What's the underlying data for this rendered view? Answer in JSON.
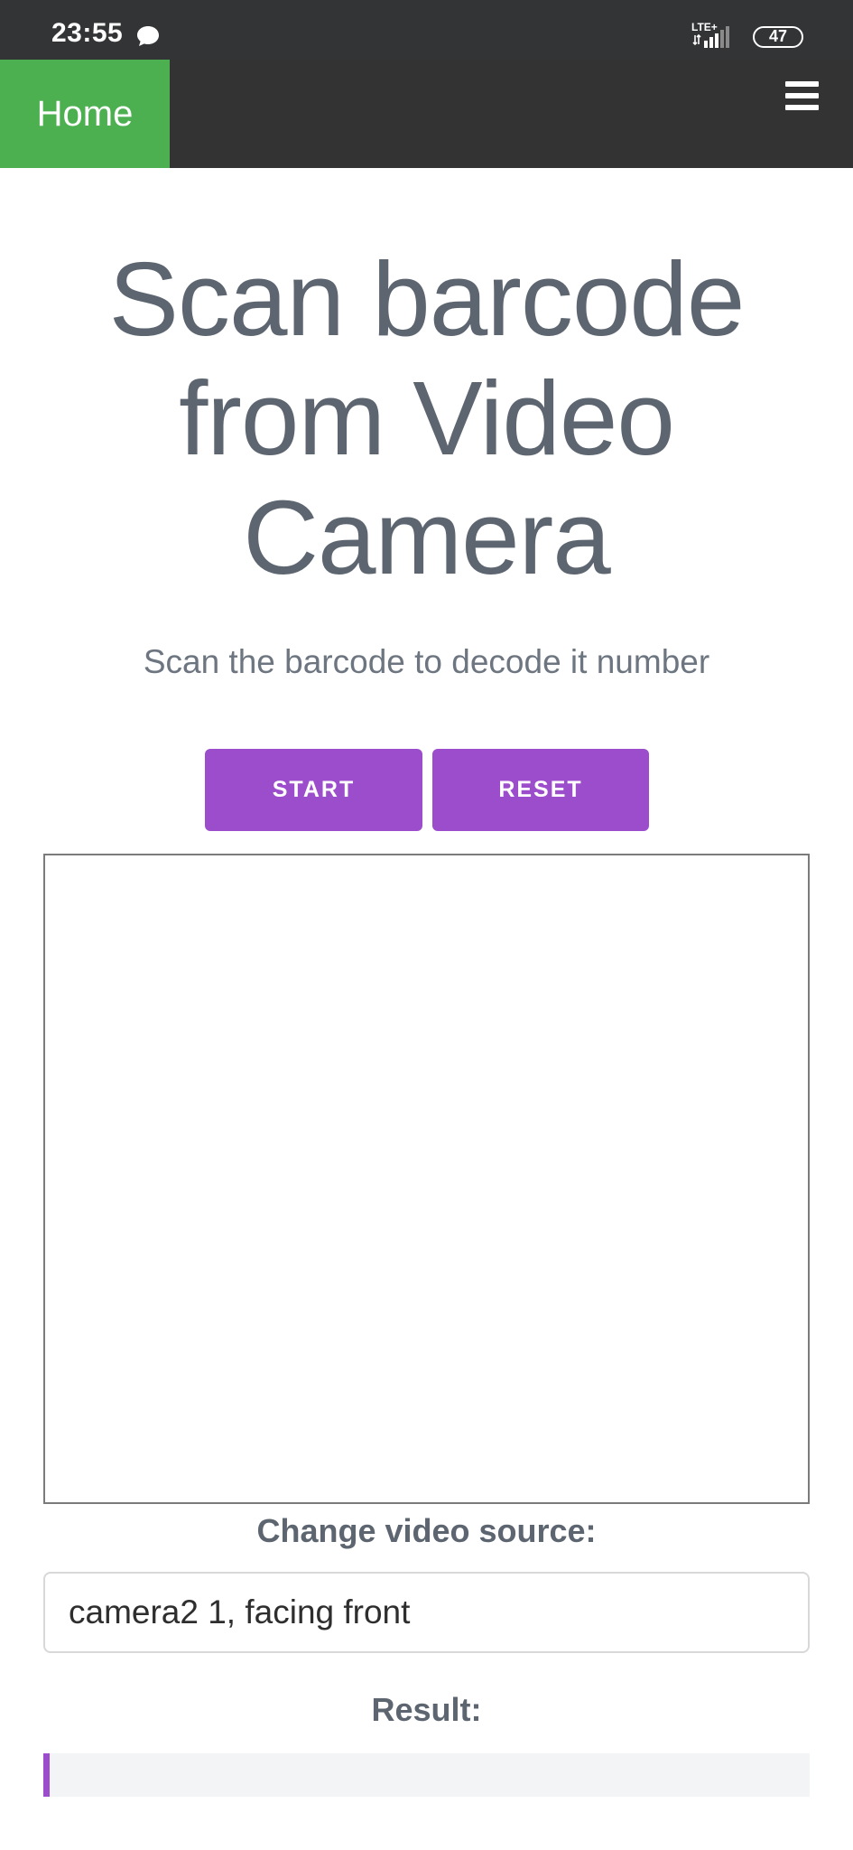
{
  "status_bar": {
    "time": "23:55",
    "network": "LTE+",
    "battery": "47",
    "icons": [
      "message-icon",
      "lte-signal-icon",
      "battery-icon"
    ]
  },
  "navbar": {
    "home_label": "Home",
    "menu_icon": "hamburger-menu-icon",
    "home_color": "#4caf50",
    "bar_color": "#333333"
  },
  "main": {
    "title": "Scan barcode from Video Camera",
    "subtitle": "Scan the barcode to decode it number",
    "start_label": "START",
    "reset_label": "RESET",
    "button_color": "#9c4dcc",
    "source_label": "Change video source:",
    "source_value": "camera2 1, facing front",
    "result_label": "Result:",
    "result_value": ""
  }
}
